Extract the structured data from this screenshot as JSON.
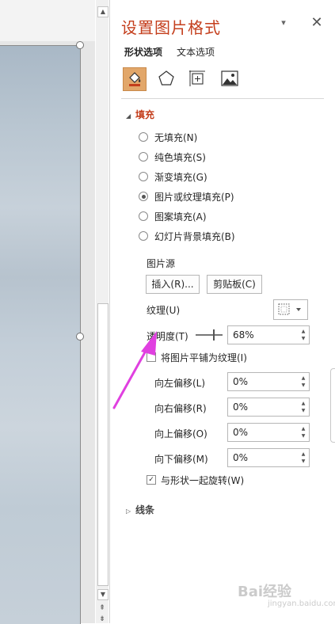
{
  "panel": {
    "title": "设置图片格式",
    "menu_glyph": "▾",
    "close_glyph": "✕",
    "tabs": [
      "形状选项",
      "文本选项"
    ],
    "category_icons": [
      "fill-line-icon",
      "effects-pentagon-icon",
      "size-properties-icon",
      "picture-icon"
    ]
  },
  "fill": {
    "header": "填充",
    "options": [
      {
        "label": "无填充(N)",
        "selected": false
      },
      {
        "label": "纯色填充(S)",
        "selected": false
      },
      {
        "label": "渐变填充(G)",
        "selected": false
      },
      {
        "label": "图片或纹理填充(P)",
        "selected": true
      },
      {
        "label": "图案填充(A)",
        "selected": false
      },
      {
        "label": "幻灯片背景填充(B)",
        "selected": false
      }
    ],
    "picture_source_label": "图片源",
    "insert_button": "插入(R)...",
    "clipboard_button": "剪贴板(C)",
    "texture_label": "纹理(U)",
    "transparency_label": "透明度(T)",
    "transparency_value": "68%",
    "transparency_fraction": 0.68,
    "tile_label": "将图片平铺为纹理(I)",
    "tile_checked": false,
    "offset_left_label": "向左偏移(L)",
    "offset_left_value": "0%",
    "offset_right_label": "向右偏移(R)",
    "offset_right_value": "0%",
    "offset_top_label": "向上偏移(O)",
    "offset_top_value": "0%",
    "offset_bottom_label": "向下偏移(M)",
    "offset_bottom_value": "0%",
    "rotate_label": "与形状一起旋转(W)",
    "rotate_checked": true
  },
  "line": {
    "header": "线条"
  },
  "scrollbar": {
    "up": "▲",
    "down": "▼",
    "prev_page": "⇞",
    "next_page": "⇟"
  },
  "watermark": {
    "text": "Bai经验",
    "sub": "jingyan.baidu.com"
  },
  "colors": {
    "accent": "#c43e1c",
    "annotation": "#e040e0"
  }
}
